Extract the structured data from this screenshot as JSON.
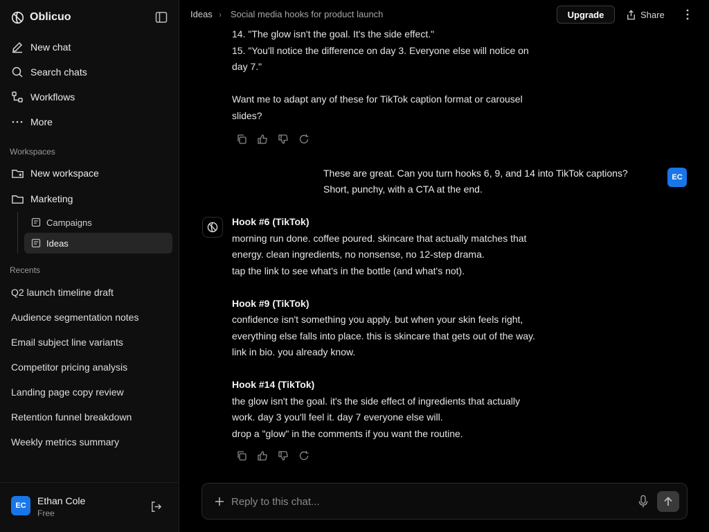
{
  "app": {
    "name": "Oblicuo"
  },
  "nav": {
    "items": [
      {
        "label": "New chat",
        "icon": "pencil-icon"
      },
      {
        "label": "Search chats",
        "icon": "search-icon"
      },
      {
        "label": "Workflows",
        "icon": "workflow-icon"
      },
      {
        "label": "More",
        "icon": "ellipsis-icon"
      }
    ]
  },
  "workspaces": {
    "title": "Workspaces",
    "new_label": "New workspace",
    "folder_label": "Marketing",
    "children": [
      {
        "label": "Campaigns"
      },
      {
        "label": "Ideas",
        "active": true
      }
    ]
  },
  "recents": {
    "title": "Recents",
    "items": [
      "Q2 launch timeline draft",
      "Audience segmentation notes",
      "Email subject line variants",
      "Competitor pricing analysis",
      "Landing page copy review",
      "Retention funnel breakdown",
      "Weekly metrics summary"
    ]
  },
  "user": {
    "name": "Ethan Cole",
    "plan": "Free",
    "initials": "EC"
  },
  "header": {
    "breadcrumb": [
      "Ideas",
      "Social media hooks for product launch"
    ],
    "separator": "›",
    "upgrade_label": "Upgrade",
    "share_label": "Share"
  },
  "messages": {
    "prev_assistant": {
      "lines": [
        "14. \"The glow isn't the goal. It's the side effect.\"",
        "15. \"You'll notice the difference on day 3. Everyone else will notice on",
        "day 7.\"",
        "Want me to adapt any of these for TikTok caption format or carousel",
        "slides?"
      ]
    },
    "user_message": {
      "lines": [
        "These are great. Can you turn hooks 6, 9, and 14 into TikTok captions?",
        "Short, punchy, with a CTA at the end."
      ]
    },
    "assistant": {
      "sections": [
        {
          "heading": "Hook #6 (TikTok)",
          "lines": [
            "morning run done. coffee poured. skincare that actually matches that",
            "energy. clean ingredients, no nonsense, no 12-step drama.",
            "tap the link to see what's in the bottle (and what's not)."
          ]
        },
        {
          "heading": "Hook #9 (TikTok)",
          "lines": [
            "confidence isn't something you apply. but when your skin feels right,",
            "everything else falls into place. this is skincare that gets out of the way.",
            "link in bio. you already know."
          ]
        },
        {
          "heading": "Hook #14 (TikTok)",
          "lines": [
            "the glow isn't the goal. it's the side effect of ingredients that actually",
            "work. day 3 you'll feel it. day 7 everyone else will.",
            "drop a \"glow\" in the comments if you want the routine."
          ]
        }
      ]
    }
  },
  "composer": {
    "placeholder": "Reply to this chat..."
  },
  "colors": {
    "accent": "#1976e8",
    "background": "#000000",
    "sidebar": "#0f0f0f"
  }
}
